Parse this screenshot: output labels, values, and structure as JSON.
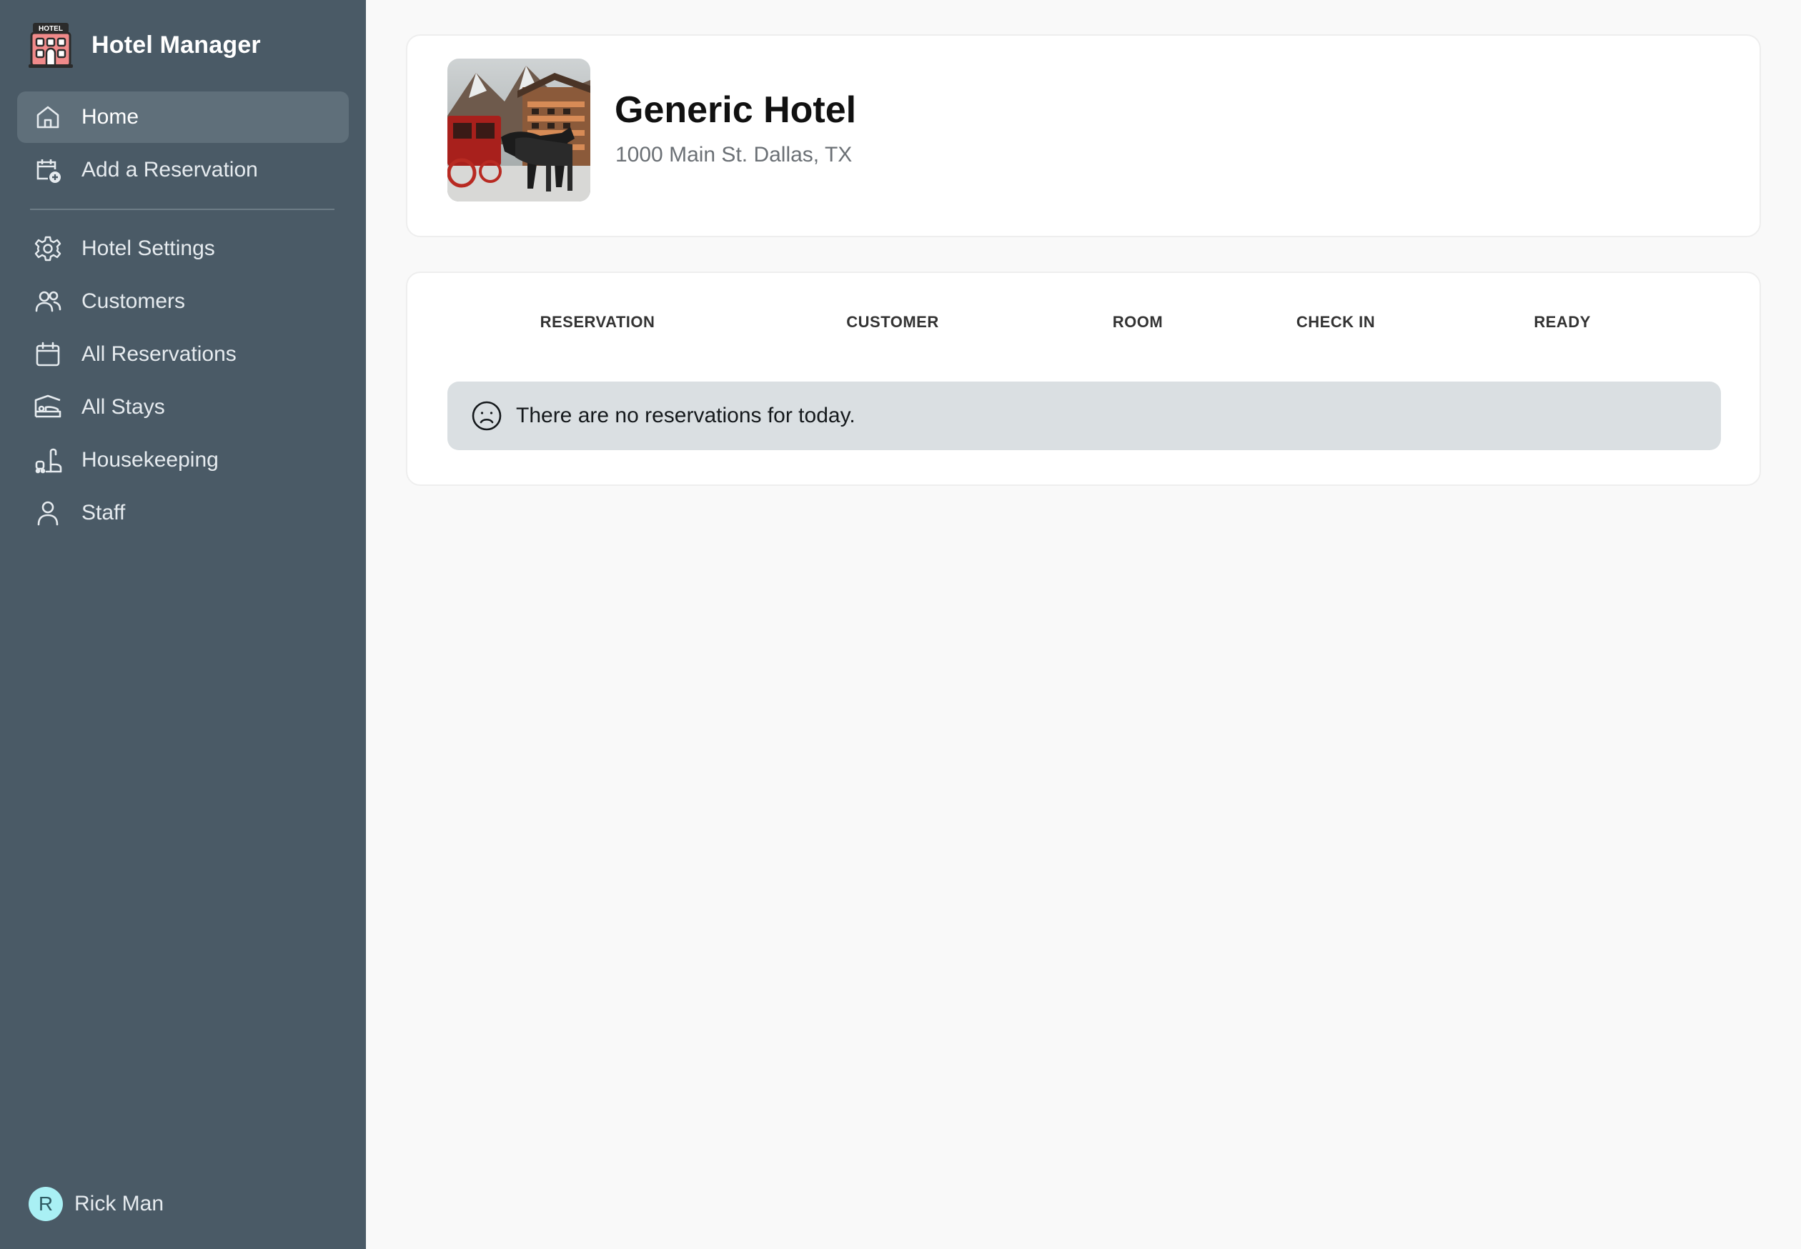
{
  "app": {
    "title": "Hotel Manager",
    "logo_icon": "hotel-building-icon",
    "logo_text": "HOTEL"
  },
  "sidebar": {
    "items": [
      {
        "label": "Home",
        "icon": "home-icon",
        "active": true
      },
      {
        "label": "Add a Reservation",
        "icon": "calendar-add-icon",
        "active": false
      },
      {
        "label": "Hotel Settings",
        "icon": "gear-icon",
        "active": false
      },
      {
        "label": "Customers",
        "icon": "users-icon",
        "active": false
      },
      {
        "label": "All Reservations",
        "icon": "calendar-icon",
        "active": false
      },
      {
        "label": "All Stays",
        "icon": "bed-icon",
        "active": false
      },
      {
        "label": "Housekeeping",
        "icon": "vacuum-icon",
        "active": false
      },
      {
        "label": "Staff",
        "icon": "person-icon",
        "active": false
      }
    ]
  },
  "user": {
    "initial": "R",
    "name": "Rick Man"
  },
  "hotel": {
    "name": "Generic Hotel",
    "address": "1000 Main St. Dallas, TX"
  },
  "reservations": {
    "columns": [
      "RESERVATION",
      "CUSTOMER",
      "ROOM",
      "CHECK IN",
      "READY"
    ],
    "empty_message": "There are no reservations for today.",
    "empty_icon": "sad-face-icon"
  },
  "colors": {
    "sidebar_bg": "#4a5a66",
    "sidebar_active": "#5f6f7a",
    "page_bg": "#f9f9f9",
    "alert_bg": "#dadfe2",
    "avatar_bg": "#a9f0f4"
  }
}
